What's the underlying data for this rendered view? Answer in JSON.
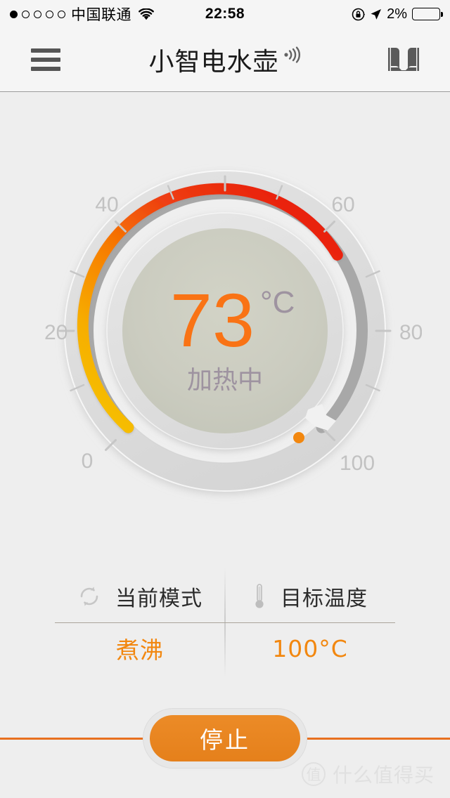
{
  "status_bar": {
    "signal_dots_total": 5,
    "signal_dots_filled": 1,
    "carrier": "中国联通",
    "wifi_icon": "wifi-icon",
    "time": "22:58",
    "lock_icon": "rotation-lock-icon",
    "location_icon": "location-arrow-icon",
    "battery_percent": "2%",
    "battery_level": 2
  },
  "header": {
    "menu_icon": "hamburger-menu-icon",
    "title": "小智电水壶",
    "signal_icon": "wave-signal-icon",
    "manual_icon": "open-book-icon"
  },
  "gauge": {
    "current_temp": "73",
    "unit": "°C",
    "status_text": "加热中",
    "min": 0,
    "max": 100,
    "tick_labels": [
      "0",
      "20",
      "40",
      "60",
      "80",
      "100"
    ],
    "tick_values": [
      0,
      20,
      40,
      60,
      80,
      100
    ],
    "minor_tick_values": [
      10,
      30,
      50,
      70,
      90
    ],
    "value_color": "#f97315",
    "unit_color": "#9e93a0",
    "status_color": "#9e93a0",
    "arc_gradient": [
      "#f5c500",
      "#f78a00",
      "#ec2a0f",
      "#e60d0d"
    ],
    "arc_remaining_color": "#a8a8a8",
    "marker_color": "#f2870f",
    "dial_face_color": "#c9cbbf"
  },
  "info": {
    "cells": [
      {
        "icon": "refresh-cycle-icon",
        "label": "当前模式",
        "value": "煮沸"
      },
      {
        "icon": "thermometer-icon",
        "label": "目标温度",
        "value": "100°C"
      }
    ]
  },
  "action": {
    "stop_label": "停止",
    "accent_color": "#e8861f"
  },
  "watermark": {
    "badge": "值",
    "text": "什么值得买"
  }
}
